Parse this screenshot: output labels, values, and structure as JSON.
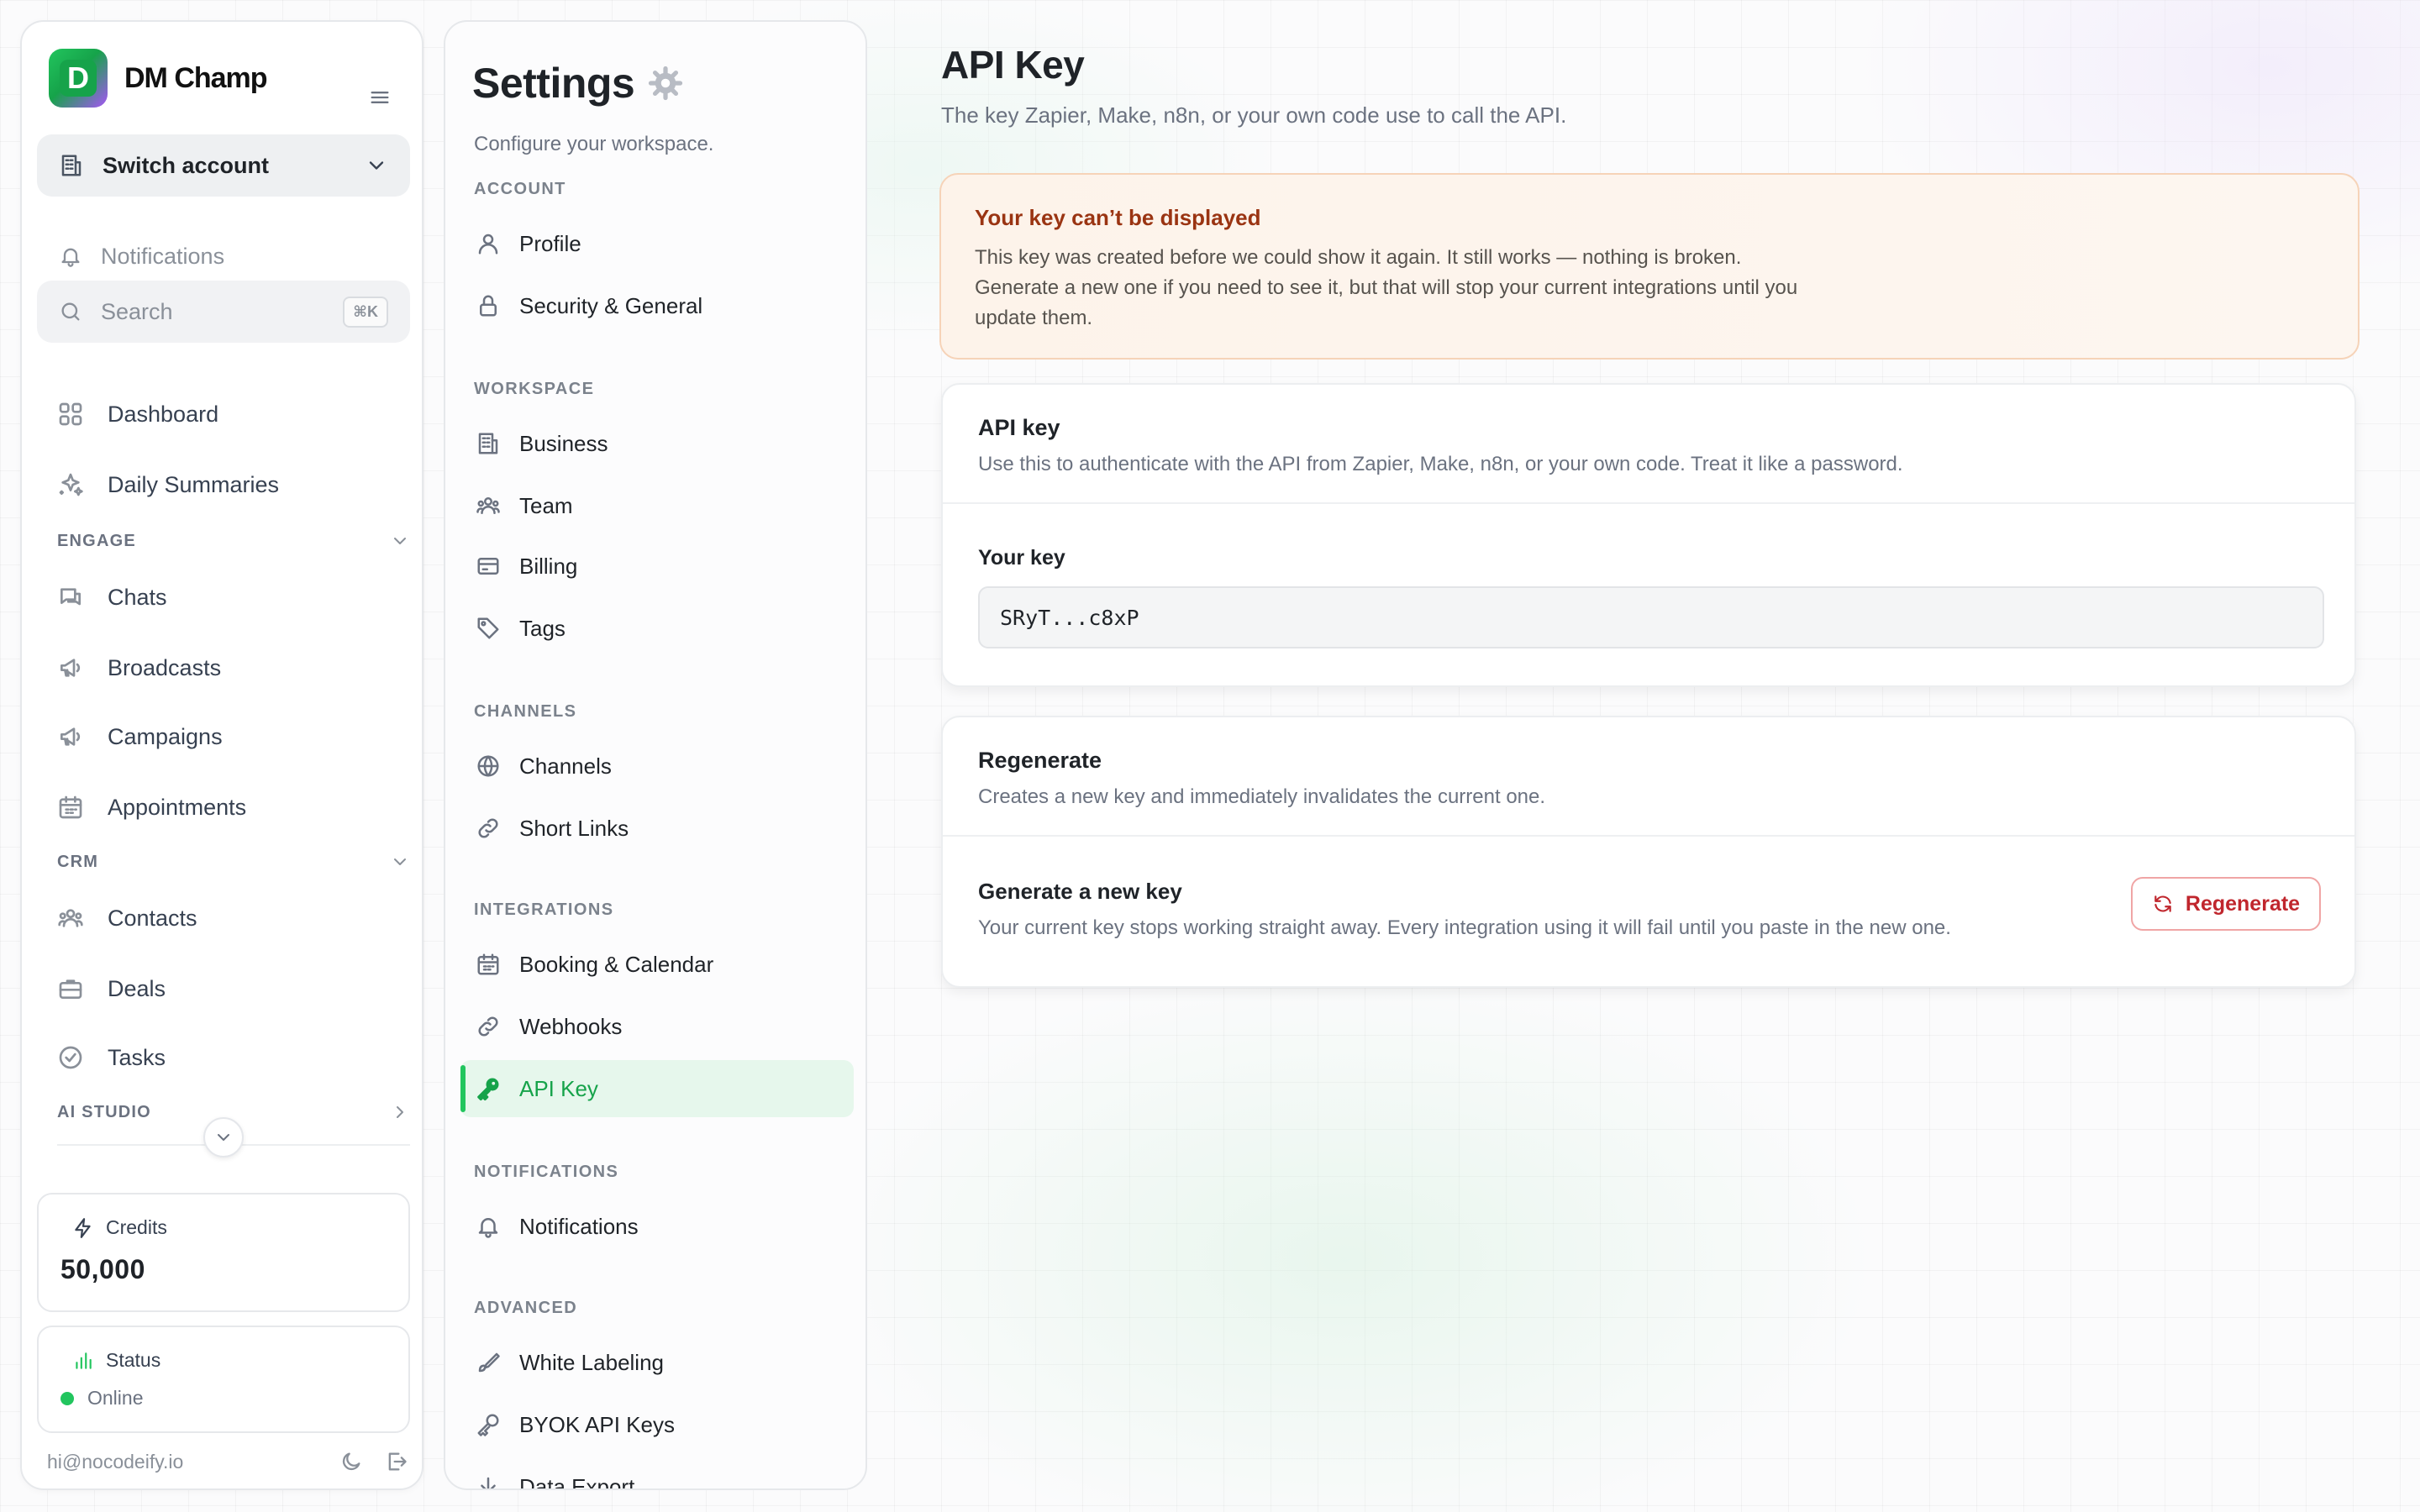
{
  "brand": {
    "name": "DM Champ",
    "logo_letter": "D"
  },
  "sidebar": {
    "switch_account": "Switch account",
    "notifications": "Notifications",
    "search_placeholder": "Search",
    "search_shortcut": "⌘K",
    "items_top": [
      {
        "label": "Dashboard",
        "icon": "grid-icon"
      },
      {
        "label": "Daily Summaries",
        "icon": "sparkles-icon"
      }
    ],
    "sections": {
      "engage": "ENGAGE",
      "crm": "CRM",
      "ai_studio": "AI STUDIO"
    },
    "engage_items": [
      {
        "label": "Chats",
        "icon": "chat-icon"
      },
      {
        "label": "Broadcasts",
        "icon": "megaphone-icon"
      },
      {
        "label": "Campaigns",
        "icon": "megaphone-icon"
      },
      {
        "label": "Appointments",
        "icon": "calendar-icon"
      }
    ],
    "crm_items": [
      {
        "label": "Contacts",
        "icon": "users-icon"
      },
      {
        "label": "Deals",
        "icon": "briefcase-icon"
      },
      {
        "label": "Tasks",
        "icon": "check-circle-icon"
      }
    ],
    "credits": {
      "label": "Credits",
      "value": "50,000"
    },
    "status": {
      "label": "Status",
      "value": "Online",
      "color": "#22c55e"
    },
    "footer_email": "hi@nocodeify.io"
  },
  "settings": {
    "title": "Settings",
    "subtitle": "Configure your workspace.",
    "sections": [
      {
        "title": "ACCOUNT",
        "items": [
          "Profile",
          "Security & General"
        ]
      },
      {
        "title": "WORKSPACE",
        "items": [
          "Business",
          "Team",
          "Billing",
          "Tags"
        ]
      },
      {
        "title": "CHANNELS",
        "items": [
          "Channels",
          "Short Links"
        ]
      },
      {
        "title": "INTEGRATIONS",
        "items": [
          "Booking & Calendar",
          "Webhooks",
          "API Key"
        ]
      },
      {
        "title": "NOTIFICATIONS",
        "items": [
          "Notifications"
        ]
      },
      {
        "title": "ADVANCED",
        "items": [
          "White Labeling",
          "BYOK API Keys",
          "Data Export"
        ]
      }
    ],
    "active_item": "API Key"
  },
  "main": {
    "title": "API Key",
    "subtitle": "The key Zapier, Make, n8n, or your own code use to call the API.",
    "warning": {
      "title": "Your key can’t be displayed",
      "body": "This key was created before we could show it again. It still works — nothing is broken. Generate a new one if you need to see it, but that will stop your current integrations until you update them."
    },
    "api_card": {
      "title": "API key",
      "description": "Use this to authenticate with the API from Zapier, Make, n8n, or your own code. Treat it like a password.",
      "key_label": "Your key",
      "key_value": "SRyT...c8xP"
    },
    "regen_card": {
      "title": "Regenerate",
      "description": "Creates a new key and immediately invalidates the current one.",
      "action_title": "Generate a new key",
      "action_description": "Your current key stops working straight away. Every integration using it will fail until you paste in the new one.",
      "button_label": "Regenerate"
    }
  },
  "colors": {
    "accent": "#16a34a",
    "active_bg": "#e6f7ec",
    "warning_title": "#9a3412",
    "danger": "#c0262d"
  }
}
